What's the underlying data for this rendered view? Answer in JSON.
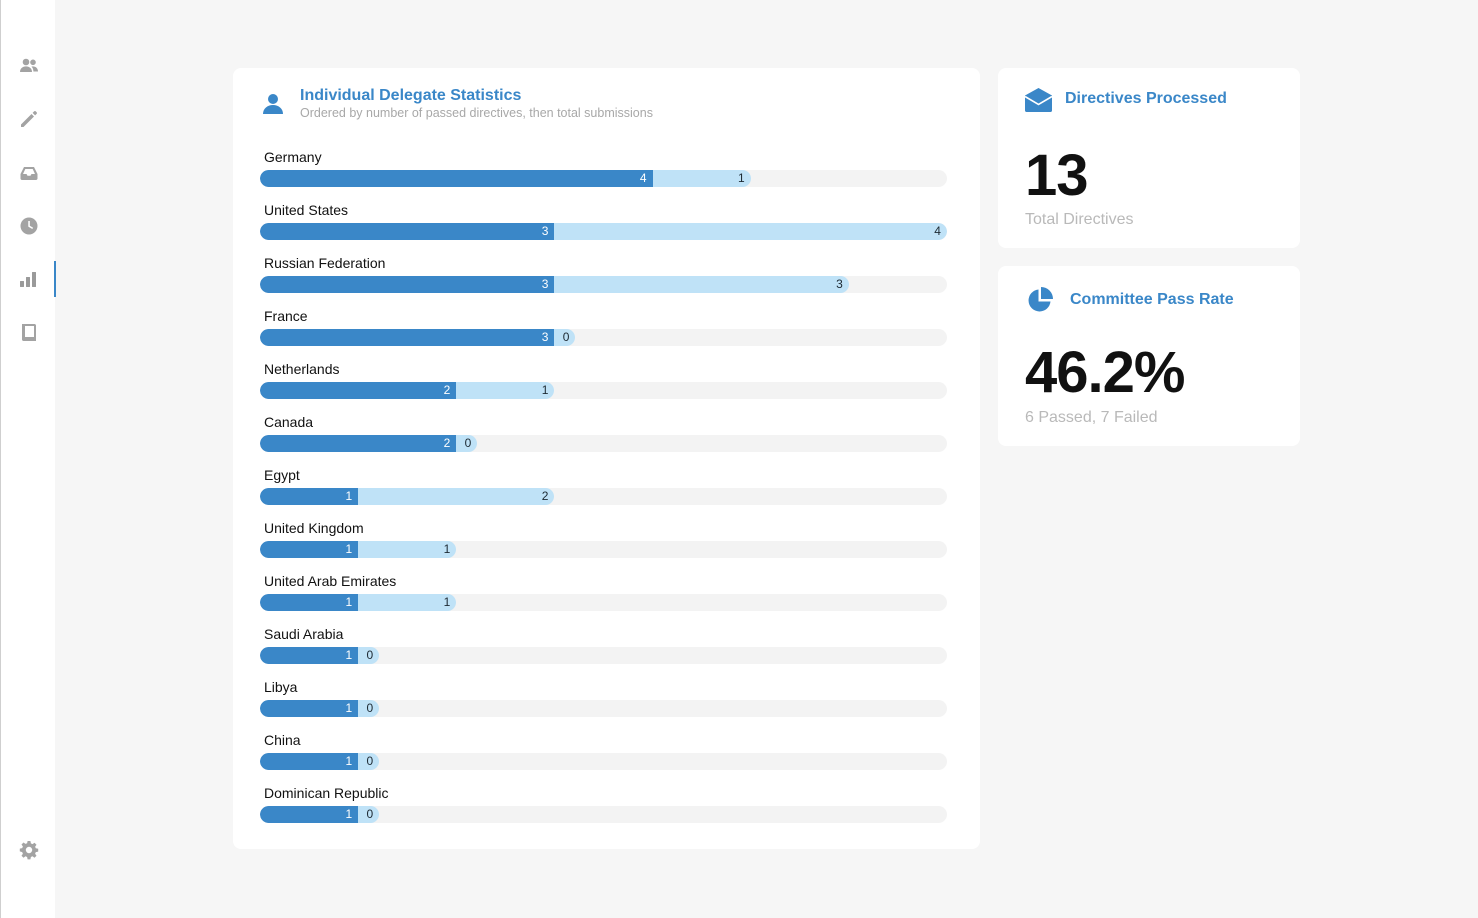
{
  "sidebar": {
    "items": [
      {
        "icon": "users-icon",
        "name": "nav-delegates"
      },
      {
        "icon": "pencil-icon",
        "name": "nav-edit"
      },
      {
        "icon": "inbox-icon",
        "name": "nav-inbox"
      },
      {
        "icon": "clock-icon",
        "name": "nav-history"
      },
      {
        "icon": "bar-chart-icon",
        "name": "nav-statistics",
        "active": true
      },
      {
        "icon": "book-icon",
        "name": "nav-guide"
      }
    ],
    "settings_icon": "gear-icon"
  },
  "stats": {
    "title": "Individual Delegate Statistics",
    "subtitle": "Ordered by number of passed directives, then total submissions",
    "icon": "user-icon"
  },
  "chart_data": {
    "type": "bar",
    "stacked": true,
    "orientation": "horizontal",
    "scale_max": 7,
    "categories": [
      "Germany",
      "United States",
      "Russian Federation",
      "France",
      "Netherlands",
      "Canada",
      "Egypt",
      "United Kingdom",
      "United Arab Emirates",
      "Saudi Arabia",
      "Libya",
      "China",
      "Dominican Republic"
    ],
    "series": [
      {
        "values": [
          4,
          3,
          3,
          3,
          2,
          2,
          1,
          1,
          1,
          1,
          1,
          1,
          1
        ],
        "color": "#3a87c8"
      },
      {
        "values": [
          1,
          4,
          3,
          0,
          1,
          0,
          2,
          1,
          1,
          0,
          0,
          0,
          0
        ],
        "color": "#bfe2f7"
      }
    ]
  },
  "directives": {
    "icon": "envelope-icon",
    "title": "Directives Processed",
    "value": "13",
    "caption": "Total Directives"
  },
  "passrate": {
    "icon": "pie-chart-icon",
    "title": "Committee Pass Rate",
    "value": "46.2%",
    "caption": "6 Passed, 7 Failed"
  },
  "colors": {
    "accent": "#3a87c8",
    "pass": "#3a87c8",
    "fail": "#bfe2f7",
    "track": "#f3f3f3"
  }
}
